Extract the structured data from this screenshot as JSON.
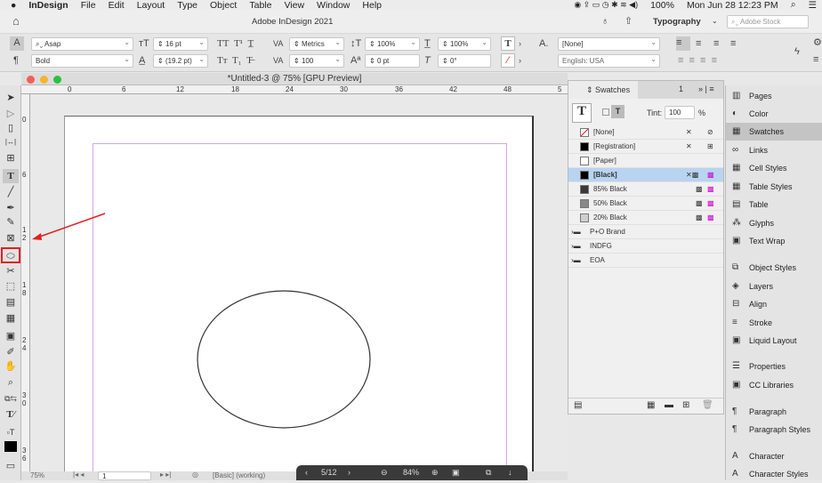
{
  "menubar": {
    "app": "InDesign",
    "items": [
      "File",
      "Edit",
      "Layout",
      "Type",
      "Object",
      "Table",
      "View",
      "Window",
      "Help"
    ],
    "battery": "100%",
    "datetime": "Mon Jun 28  12:23 PM"
  },
  "appbar": {
    "title": "Adobe InDesign 2021",
    "workspace": "Typography",
    "search_placeholder": "Adobe Stock"
  },
  "control": {
    "font": "Asap",
    "style": "Bold",
    "size": "16 pt",
    "leading": "(19.2 pt)",
    "kerning": "Metrics",
    "tracking": "100",
    "vscale": "100%",
    "baseline": "0 pt",
    "hscale": "100%",
    "skew": "0°",
    "char_style": "[None]",
    "language": "English: USA"
  },
  "document": {
    "title": "*Untitled-3 @ 75% [GPU Preview]",
    "ruler_marks": [
      "0",
      "6",
      "12",
      "18",
      "24",
      "30",
      "36",
      "42",
      "48",
      "5"
    ],
    "vruler_marks": [
      "0",
      "6",
      "1 2",
      "1 8",
      "2 4",
      "3 0",
      "3 6"
    ]
  },
  "swatches": {
    "tab": "Swatches",
    "tab2": "1",
    "tint_label": "Tint:",
    "tint": "100",
    "pct": "%",
    "items": [
      {
        "name": "[None]",
        "color": "none"
      },
      {
        "name": "[Registration]",
        "color": "#000000"
      },
      {
        "name": "[Paper]",
        "color": "#ffffff"
      },
      {
        "name": "[Black]",
        "color": "#000000",
        "selected": true
      },
      {
        "name": "85% Black",
        "color": "#3a3a3a"
      },
      {
        "name": "50% Black",
        "color": "#888888"
      },
      {
        "name": "20% Black",
        "color": "#cfcfcf"
      }
    ],
    "groups": [
      "P+O Brand",
      "INDFG",
      "EOA"
    ]
  },
  "dock": {
    "items": [
      "Pages",
      "Color",
      "Swatches",
      "Links",
      "Cell Styles",
      "Table Styles",
      "Table",
      "Glyphs",
      "Text Wrap",
      "Object Styles",
      "Layers",
      "Align",
      "Stroke",
      "Liquid Layout",
      "Properties",
      "CC Libraries",
      "Paragraph",
      "Paragraph Styles",
      "Character",
      "Character Styles"
    ]
  },
  "status": {
    "zoom": "75%",
    "page": "1",
    "style": "[Basic] (working)"
  },
  "overlay": {
    "page": "5/12",
    "zoom": "84%"
  },
  "colors": {
    "highlight": "#b8d4f0",
    "annotation": "#e02020"
  }
}
